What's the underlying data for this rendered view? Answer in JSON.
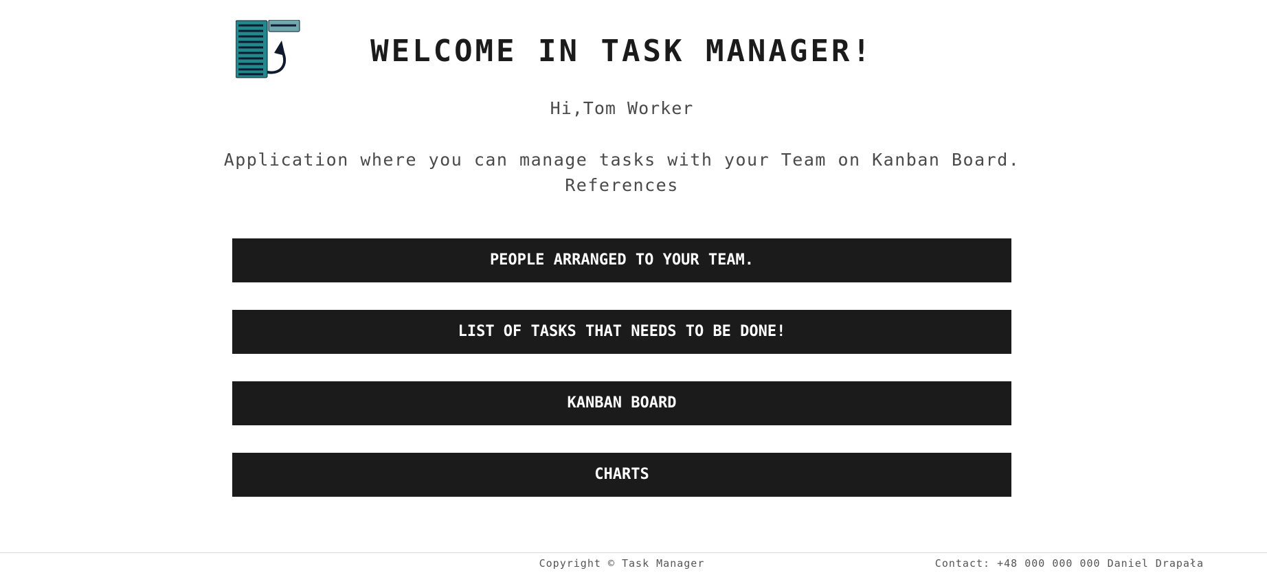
{
  "header": {
    "logo_icon": "task-list-logo-icon",
    "title": "WELCOME IN TASK MANAGER!"
  },
  "user": {
    "greeting": "Hi,Tom Worker"
  },
  "intro": {
    "line1": "Application where you can manage tasks with your Team on Kanban Board.",
    "line2": "References"
  },
  "menu": {
    "items": [
      {
        "label": "PEOPLE ARRANGED TO YOUR TEAM."
      },
      {
        "label": "LIST OF TASKS THAT NEEDS TO BE DONE!"
      },
      {
        "label": "KANBAN BOARD"
      },
      {
        "label": "CHARTS"
      }
    ]
  },
  "footer": {
    "copyright": "Copyright © Task Manager",
    "contact": "Contact: +48 000 000 000 Daniel Drapała"
  },
  "colors": {
    "button_bg": "#1b1b1b",
    "button_text": "#ffffff",
    "logo_teal": "#1f8a8e",
    "logo_light": "#6fa7ad",
    "logo_dark": "#0f1a2e"
  }
}
